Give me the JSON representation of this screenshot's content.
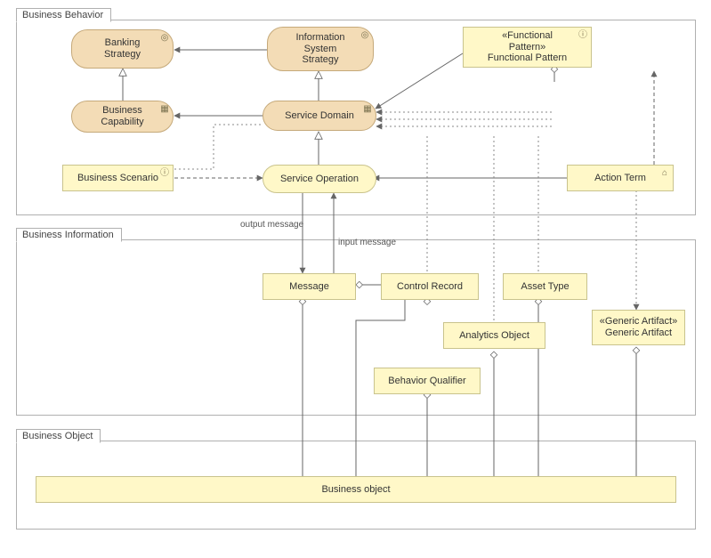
{
  "sections": {
    "behavior": {
      "label": "Business Behavior"
    },
    "information": {
      "label": "Business Information"
    },
    "object": {
      "label": "Business Object"
    }
  },
  "nodes": {
    "banking_strategy": "Banking\nStrategy",
    "info_system_strategy": "Information\nSystem\nStrategy",
    "functional_pattern_stereo": "«Functional\nPattern»",
    "functional_pattern_name": "Functional Pattern",
    "business_capability": "Business\nCapability",
    "service_domain": "Service Domain",
    "action_term": "Action Term",
    "business_scenario": "Business Scenario",
    "service_operation": "Service Operation",
    "message": "Message",
    "control_record": "Control Record",
    "asset_type": "Asset Type",
    "analytics_object": "Analytics Object",
    "generic_artifact_stereo": "«Generic Artifact»",
    "generic_artifact_name": "Generic Artifact",
    "behavior_qualifier": "Behavior Qualifier",
    "business_object": "Business object"
  },
  "edges": {
    "output_message": "output message",
    "input_message": "input message"
  },
  "icons": {
    "target": "◎",
    "grid": "▦",
    "info": "ⓘ",
    "chevron": "⌂"
  }
}
